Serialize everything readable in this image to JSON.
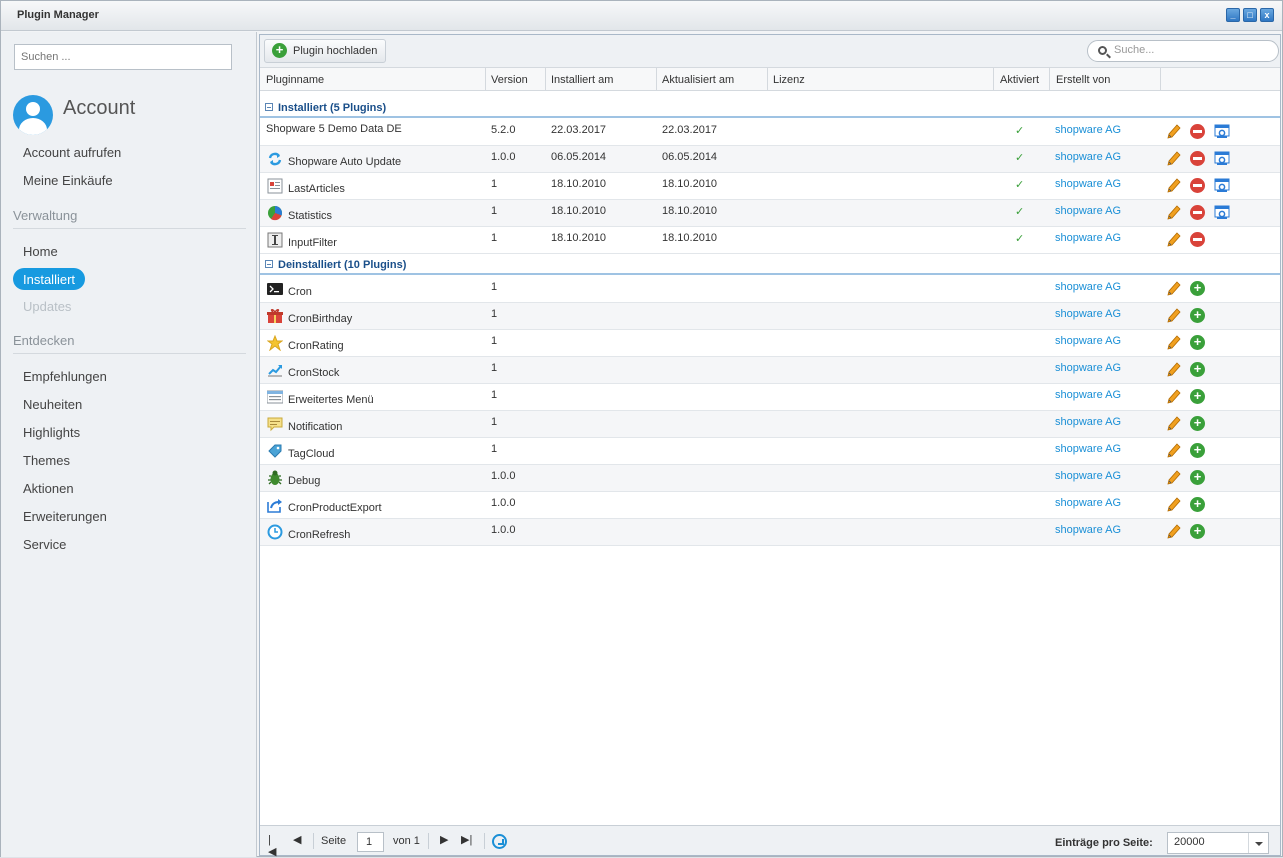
{
  "window": {
    "title": "Plugin Manager",
    "min_label": "_",
    "max_label": "□",
    "close_label": "x"
  },
  "sidebar": {
    "search_placeholder": "Suchen ...",
    "account_title": "Account",
    "account_items": [
      "Account aufrufen",
      "Meine Einkäufe"
    ],
    "section_admin": "Verwaltung",
    "admin_items": [
      "Home",
      "Installiert",
      "Updates"
    ],
    "active_item": "Installiert",
    "section_discover": "Entdecken",
    "discover_items": [
      "Empfehlungen",
      "Neuheiten",
      "Highlights",
      "Themes",
      "Aktionen",
      "Erweiterungen",
      "Service"
    ]
  },
  "toolbar": {
    "upload_label": "Plugin hochladen",
    "search_placeholder": "Suche..."
  },
  "columns": [
    "Pluginname",
    "Version",
    "Installiert am",
    "Aktualisiert am",
    "Lizenz",
    "Aktiviert",
    "Erstellt von"
  ],
  "groups": {
    "installed": {
      "label": "Installiert (5 Plugins)"
    },
    "uninstalled": {
      "label": "Deinstalliert (10 Plugins)"
    }
  },
  "installed": [
    {
      "name": "Shopware 5 Demo Data DE",
      "version": "5.2.0",
      "installed": "22.03.2017",
      "updated": "22.03.2017",
      "active": "✓",
      "author": "shopware AG",
      "icon": "none"
    },
    {
      "name": "Shopware Auto Update",
      "version": "1.0.0",
      "installed": "06.05.2014",
      "updated": "06.05.2014",
      "active": "✓",
      "author": "shopware AG",
      "icon": "refresh-arrows-icon"
    },
    {
      "name": "LastArticles",
      "version": "1",
      "installed": "18.10.2010",
      "updated": "18.10.2010",
      "active": "✓",
      "author": "shopware AG",
      "icon": "article-list-icon"
    },
    {
      "name": "Statistics",
      "version": "1",
      "installed": "18.10.2010",
      "updated": "18.10.2010",
      "active": "✓",
      "author": "shopware AG",
      "icon": "pie-chart-icon"
    },
    {
      "name": "InputFilter",
      "version": "1",
      "installed": "18.10.2010",
      "updated": "18.10.2010",
      "active": "✓",
      "author": "shopware AG",
      "icon": "text-cursor-icon"
    }
  ],
  "uninstalled": [
    {
      "name": "Cron",
      "version": "1",
      "author": "shopware AG",
      "icon": "terminal-icon"
    },
    {
      "name": "CronBirthday",
      "version": "1",
      "author": "shopware AG",
      "icon": "gift-icon"
    },
    {
      "name": "CronRating",
      "version": "1",
      "author": "shopware AG",
      "icon": "star-icon"
    },
    {
      "name": "CronStock",
      "version": "1",
      "author": "shopware AG",
      "icon": "stock-chart-icon"
    },
    {
      "name": "Erweitertes Menü",
      "version": "1",
      "author": "shopware AG",
      "icon": "menu-icon"
    },
    {
      "name": "Notification",
      "version": "1",
      "author": "shopware AG",
      "icon": "note-icon"
    },
    {
      "name": "TagCloud",
      "version": "1",
      "author": "shopware AG",
      "icon": "tag-icon"
    },
    {
      "name": "Debug",
      "version": "1.0.0",
      "author": "shopware AG",
      "icon": "bug-icon"
    },
    {
      "name": "CronProductExport",
      "version": "1.0.0",
      "author": "shopware AG",
      "icon": "export-icon"
    },
    {
      "name": "CronRefresh",
      "version": "1.0.0",
      "author": "shopware AG",
      "icon": "clock-refresh-icon"
    }
  ],
  "pager": {
    "page_label": "Seite",
    "page_value": "1",
    "of_label": "von 1",
    "per_page_label": "Einträge pro Seite:",
    "per_page_value": "20000"
  },
  "colors": {
    "accent": "#179ae0",
    "author_link": "#1a8fd6",
    "group_text": "#1a4f8a",
    "check": "#3aa03a",
    "delete": "#d9433a"
  }
}
